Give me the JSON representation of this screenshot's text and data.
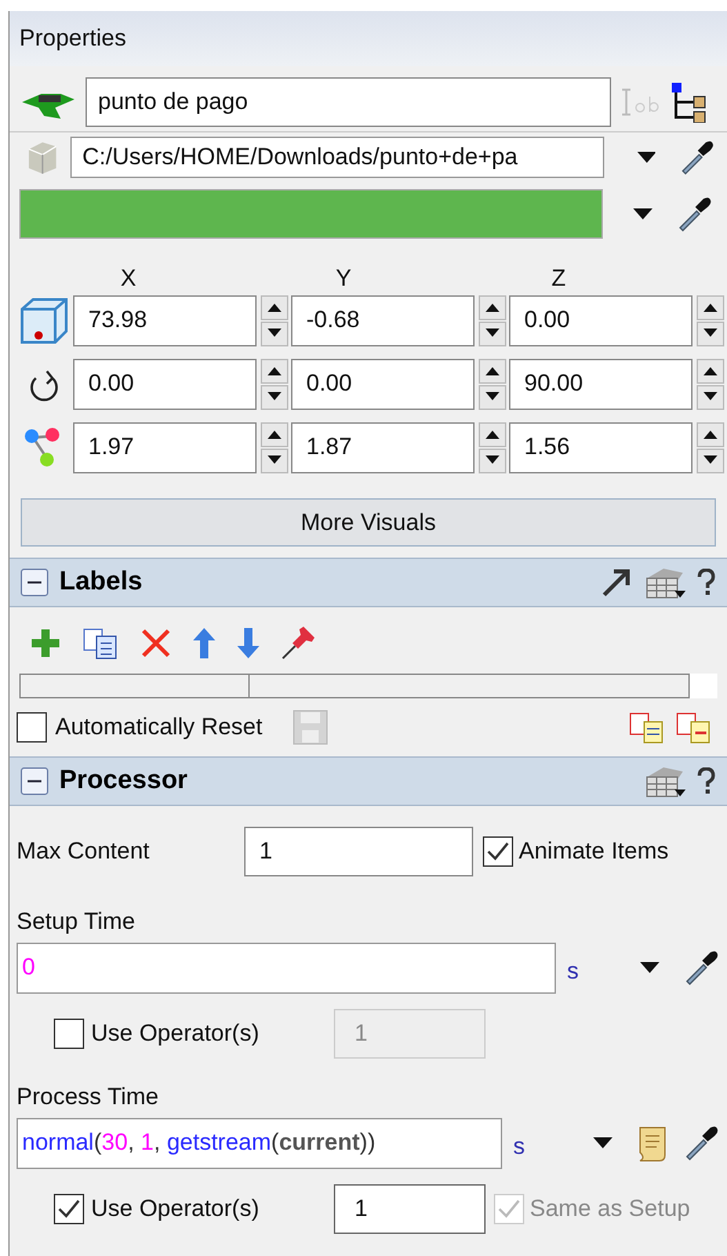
{
  "panel": {
    "title": "Properties"
  },
  "object": {
    "name": "punto de pago",
    "shape_path": "C:/Users/HOME/Downloads/punto+de+pa",
    "color": "#5eb64e"
  },
  "transform": {
    "columns": [
      "X",
      "Y",
      "Z"
    ],
    "rows": [
      {
        "kind": "position",
        "values": [
          "73.98",
          "-0.68",
          "0.00"
        ]
      },
      {
        "kind": "rotation",
        "values": [
          "0.00",
          "0.00",
          "90.00"
        ]
      },
      {
        "kind": "size",
        "values": [
          "1.97",
          "1.87",
          "1.56"
        ]
      }
    ]
  },
  "more_visuals_button": "More Visuals",
  "labels_section": {
    "title": "Labels",
    "expanded": true,
    "automatically_reset": {
      "label": "Automatically Reset",
      "checked": false
    }
  },
  "processor_section": {
    "title": "Processor",
    "expanded": true,
    "max_content": {
      "label": "Max Content",
      "value": "1"
    },
    "animate_items": {
      "label": "Animate Items",
      "checked": true
    },
    "setup_time": {
      "label": "Setup Time",
      "tokens": [
        {
          "text": "0",
          "kind": "number"
        }
      ],
      "unit": "s",
      "use_operators": {
        "label": "Use Operator(s)",
        "checked": false,
        "value": "1",
        "disabled": true
      }
    },
    "process_time": {
      "label": "Process Time",
      "tokens": [
        {
          "text": "normal",
          "kind": "function"
        },
        {
          "text": "(",
          "kind": "punct"
        },
        {
          "text": "30",
          "kind": "number"
        },
        {
          "text": ", ",
          "kind": "punct"
        },
        {
          "text": "1",
          "kind": "number"
        },
        {
          "text": ", ",
          "kind": "punct"
        },
        {
          "text": "getstream",
          "kind": "function"
        },
        {
          "text": "(",
          "kind": "punct"
        },
        {
          "text": "current",
          "kind": "keyword"
        },
        {
          "text": "))",
          "kind": "punct"
        }
      ],
      "unit": "s",
      "use_operators": {
        "label": "Use Operator(s)",
        "checked": true,
        "value": "1",
        "disabled": false
      },
      "same_as_setup": {
        "label": "Same as Setup",
        "checked": true,
        "disabled": true
      }
    }
  }
}
